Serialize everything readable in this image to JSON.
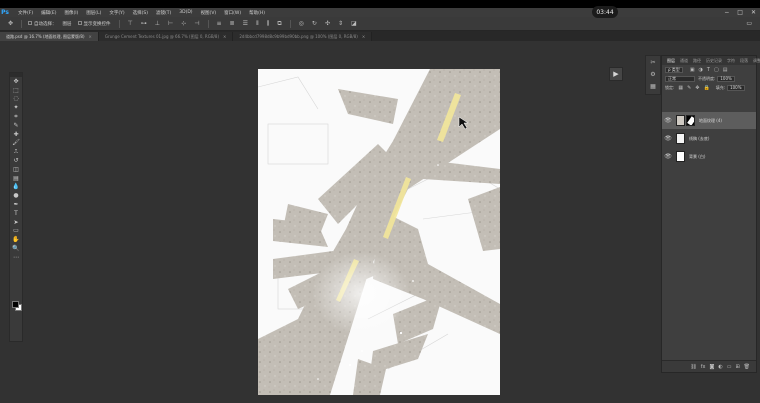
{
  "overlay": {
    "timer": "03:44"
  },
  "app": {
    "logo": "Ps"
  },
  "menu": [
    "文件(F)",
    "编辑(E)",
    "图像(I)",
    "图层(L)",
    "文字(Y)",
    "选择(S)",
    "滤镜(T)",
    "3D(D)",
    "视图(V)",
    "窗口(W)",
    "帮助(H)"
  ],
  "window_controls": {
    "minimize": "−",
    "maximize": "□",
    "close": "✕"
  },
  "options": {
    "auto_select_label": "自动选择：",
    "auto_select_value": "图层",
    "show_transform_label": "显示变换控件"
  },
  "tabs": [
    {
      "label": "道路.psd @ 16.7% (地面纹理, 图层蒙版/8)",
      "active": true
    },
    {
      "label": "Grunge Cement Textures 01.jpg @ 66.7% (图层 0, RGB/8)",
      "active": false
    },
    {
      "label": "2d4bbcd7998d8c9b99bd90bb.png @ 100% (图层 0, RGB/8)",
      "active": false
    }
  ],
  "tools": [
    "move-icon",
    "marquee-icon",
    "lasso-icon",
    "magic-wand-icon",
    "crop-icon",
    "eyedropper-icon",
    "healing-icon",
    "brush-icon",
    "stamp-icon",
    "history-brush-icon",
    "eraser-icon",
    "gradient-icon",
    "blur-icon",
    "dodge-icon",
    "pen-icon",
    "type-icon",
    "path-select-icon",
    "shape-icon",
    "hand-icon",
    "zoom-icon",
    "more-icon"
  ],
  "tool_glyphs": [
    "✥",
    "⬚",
    "◌",
    "✦",
    "⌗",
    "✎",
    "✚",
    "🖌",
    "⎍",
    "↺",
    "◫",
    "▤",
    "💧",
    "●",
    "✒",
    "T",
    "➤",
    "▭",
    "✋",
    "🔍",
    "⋯"
  ],
  "swatches": {
    "foreground": "#000000",
    "background": "#ffffff"
  },
  "layers_panel": {
    "tabs": [
      "图层",
      "通道",
      "路径",
      "历史记录",
      "字符",
      "段落",
      "调整"
    ],
    "kind_label": "ρ 类型",
    "blend_mode": "正常",
    "opacity_label": "不透明度:",
    "opacity_value": "100%",
    "lock_label": "锁定:",
    "fill_label": "填充:",
    "fill_value": "100%",
    "layers": [
      {
        "name": "地面纹理 (4)",
        "selected": true,
        "has_mask": true
      },
      {
        "name": "线稿 (去底)",
        "selected": false,
        "has_mask": false
      },
      {
        "name": "背景 (白)",
        "selected": false,
        "has_mask": false
      }
    ]
  },
  "colors": {
    "accent": "#31a8ff",
    "canvas_bg": "#323232",
    "panel_bg": "#3f3f3f",
    "selected_layer": "#5d5d5d",
    "texture": "#c2bdb5",
    "road_highlight": "#f4ea9a"
  }
}
